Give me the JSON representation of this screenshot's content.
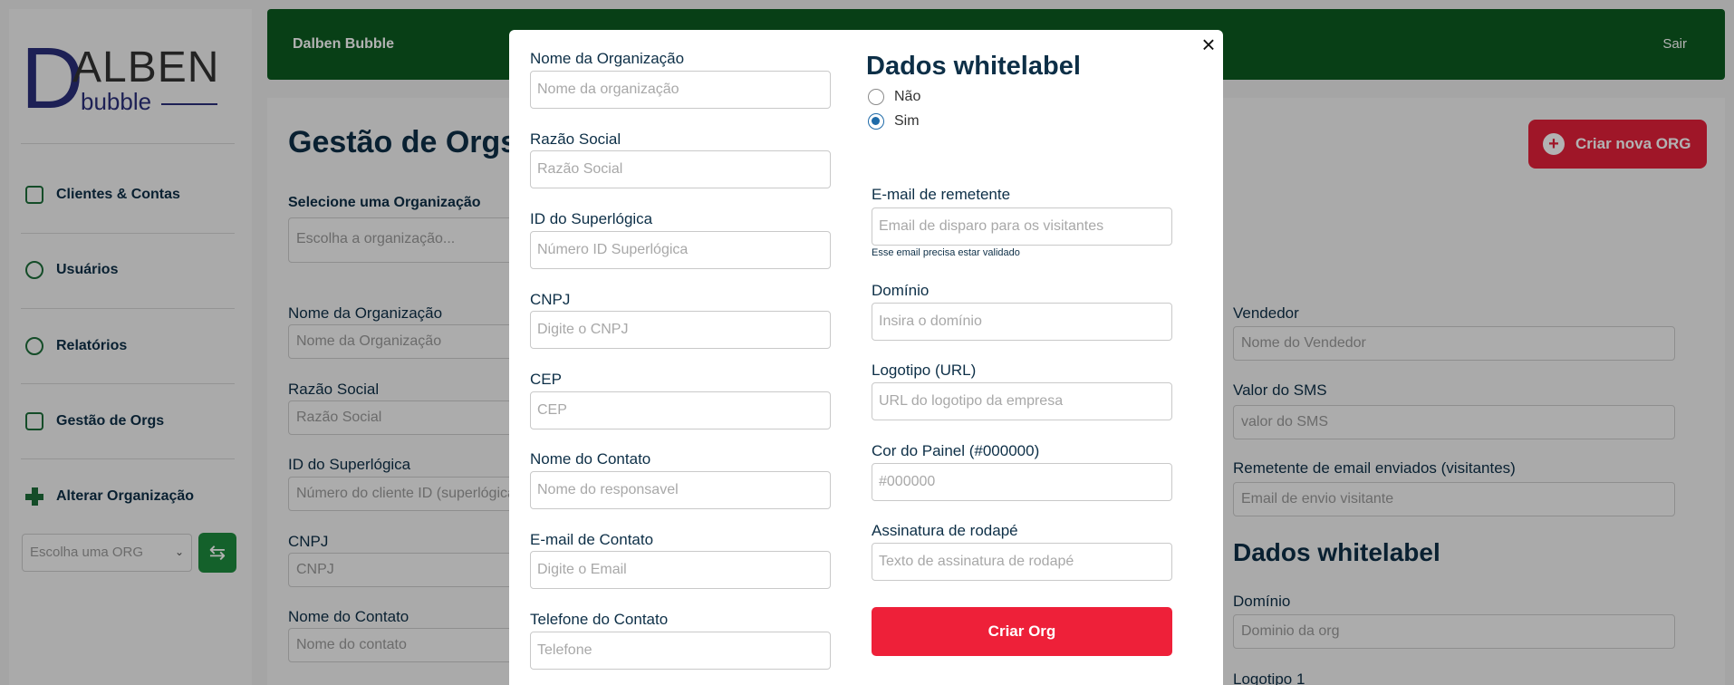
{
  "sidebar": {
    "logo": {
      "d": "D",
      "alben": "ALBEN",
      "bubble": "bubble"
    },
    "items": [
      {
        "label": "Clientes & Contas",
        "icon": "store-icon"
      },
      {
        "label": "Usuários",
        "icon": "user-circle-icon"
      },
      {
        "label": "Relatórios",
        "icon": "reports-icon"
      },
      {
        "label": "Gestão de Orgs",
        "icon": "buildings-icon"
      },
      {
        "label": "Alterar Organização",
        "icon": "plus-cross-icon"
      }
    ],
    "org_select_placeholder": "Escolha uma ORG",
    "swap_icon": "⇆"
  },
  "topbar": {
    "app_name": "Dalben Bubble",
    "logout": "Sair"
  },
  "page": {
    "title": "Gestão de Orgs",
    "create_button": "Criar nova ORG",
    "select_org_label": "Selecione uma Organização",
    "select_org_placeholder": "Escolha a organização...",
    "left_fields": [
      {
        "label": "Nome da Organização",
        "placeholder": "Nome da Organização"
      },
      {
        "label": "Razão Social",
        "placeholder": "Razão Social"
      },
      {
        "label": "ID do Superlógica",
        "placeholder": "Número do cliente ID (superlógica)"
      },
      {
        "label": "CNPJ",
        "placeholder": "CNPJ"
      },
      {
        "label": "Nome do Contato",
        "placeholder": "Nome do contato"
      }
    ],
    "right_fields": [
      {
        "label": "Vendedor",
        "placeholder": "Nome do Vendedor"
      },
      {
        "label": "Valor do SMS",
        "placeholder": "valor do SMS"
      },
      {
        "label": "Remetente de email enviados (visitantes)",
        "placeholder": "Email de envio visitante"
      }
    ],
    "whitelabel_title": "Dados whitelabel",
    "domain_label": "Domínio",
    "domain_placeholder": "Dominio da org",
    "logo1_label": "Logotipo 1"
  },
  "modal": {
    "left_fields": [
      {
        "label": "Nome da Organização",
        "placeholder": "Nome da organização"
      },
      {
        "label": "Razão Social",
        "placeholder": "Razão Social"
      },
      {
        "label": "ID do Superlógica",
        "placeholder": "Número ID Superlógica"
      },
      {
        "label": "CNPJ",
        "placeholder": "Digite o CNPJ"
      },
      {
        "label": "CEP",
        "placeholder": "CEP"
      },
      {
        "label": "Nome do Contato",
        "placeholder": "Nome do responsavel"
      },
      {
        "label": "E-mail de Contato",
        "placeholder": "Digite o Email"
      },
      {
        "label": "Telefone do Contato",
        "placeholder": "Telefone"
      }
    ],
    "whitelabel_title": "Dados whitelabel",
    "radio_no": "Não",
    "radio_yes": "Sim",
    "whitelabel_selected": "Sim",
    "sender_email": {
      "label": "E-mail de remetente",
      "placeholder": "Email de disparo para os visitantes",
      "hint": "Esse email precisa estar validado"
    },
    "domain": {
      "label": "Domínio",
      "placeholder": "Insira o domínio"
    },
    "logo_url": {
      "label": "Logotipo (URL)",
      "placeholder": "URL do logotipo da empresa"
    },
    "panel_color": {
      "label": "Cor do Painel (#000000)",
      "placeholder": "#000000"
    },
    "footer_signature": {
      "label": "Assinatura de rodapé",
      "placeholder": "Texto de assinatura de rodapé"
    },
    "submit": "Criar Org",
    "close": "×"
  },
  "colors": {
    "brand_green": "#0c5b20",
    "accent_red": "#ee2039",
    "navy": "#0d2f47"
  }
}
